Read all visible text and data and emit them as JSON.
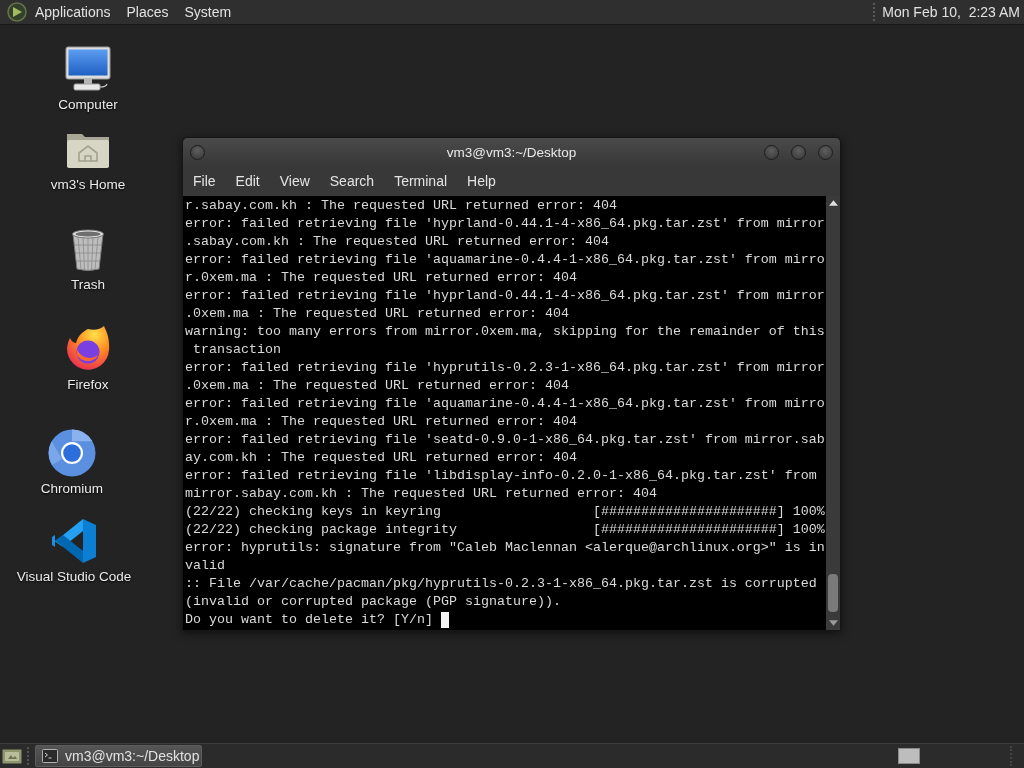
{
  "top_panel": {
    "menus": [
      "Applications",
      "Places",
      "System"
    ],
    "clock": "Mon Feb 10,  2:23 AM"
  },
  "desktop_icons": [
    {
      "label": "Computer",
      "kind": "computer"
    },
    {
      "label": "vm3's Home",
      "kind": "home"
    },
    {
      "label": "Trash",
      "kind": "trash"
    },
    {
      "label": "Firefox",
      "kind": "firefox"
    },
    {
      "label": "Chromium",
      "kind": "chromium"
    },
    {
      "label": "Visual Studio Code",
      "kind": "vscode"
    }
  ],
  "terminal_window": {
    "title": "vm3@vm3:~/Desktop",
    "menus": [
      "File",
      "Edit",
      "View",
      "Search",
      "Terminal",
      "Help"
    ],
    "lines": [
      "r.sabay.com.kh : The requested URL returned error: 404",
      "error: failed retrieving file 'hyprland-0.44.1-4-x86_64.pkg.tar.zst' from mirror",
      ".sabay.com.kh : The requested URL returned error: 404",
      "error: failed retrieving file 'aquamarine-0.4.4-1-x86_64.pkg.tar.zst' from mirro",
      "r.0xem.ma : The requested URL returned error: 404",
      "error: failed retrieving file 'hyprland-0.44.1-4-x86_64.pkg.tar.zst' from mirror",
      ".0xem.ma : The requested URL returned error: 404",
      "warning: too many errors from mirror.0xem.ma, skipping for the remainder of this",
      " transaction",
      "error: failed retrieving file 'hyprutils-0.2.3-1-x86_64.pkg.tar.zst' from mirror",
      ".0xem.ma : The requested URL returned error: 404",
      "error: failed retrieving file 'aquamarine-0.4.4-1-x86_64.pkg.tar.zst' from mirro",
      "r.0xem.ma : The requested URL returned error: 404",
      "error: failed retrieving file 'seatd-0.9.0-1-x86_64.pkg.tar.zst' from mirror.sab",
      "ay.com.kh : The requested URL returned error: 404",
      "error: failed retrieving file 'libdisplay-info-0.2.0-1-x86_64.pkg.tar.zst' from",
      "mirror.sabay.com.kh : The requested URL returned error: 404",
      "(22/22) checking keys in keyring                   [######################] 100%",
      "(22/22) checking package integrity                 [######################] 100%",
      "error: hyprutils: signature from \"Caleb Maclennan <alerque@archlinux.org>\" is in",
      "valid",
      ":: File /var/cache/pacman/pkg/hyprutils-0.2.3-1-x86_64.pkg.tar.zst is corrupted",
      "(invalid or corrupted package (PGP signature)).",
      "Do you want to delete it? [Y/n]"
    ],
    "cursor": true
  },
  "bottom_panel": {
    "tasks": [
      {
        "title": "vm3@vm3:~/Desktop",
        "selected": true
      }
    ]
  }
}
